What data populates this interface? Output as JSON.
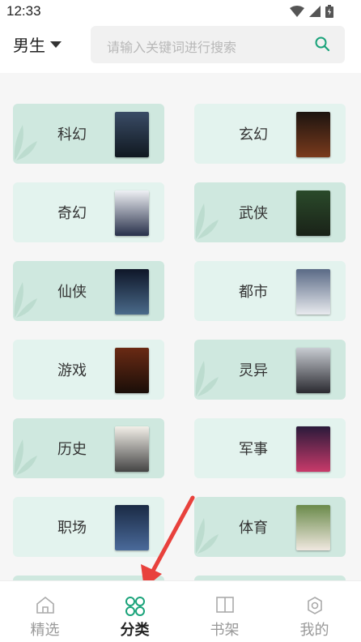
{
  "status_bar": {
    "time": "12:33"
  },
  "header": {
    "gender_label": "男生",
    "search_placeholder": "请输入关键词进行搜索"
  },
  "categories": [
    {
      "label": "科幻",
      "cover_color": "#1e2a3a"
    },
    {
      "label": "玄幻",
      "cover_color": "#3a2418"
    },
    {
      "label": "奇幻",
      "cover_color": "#2a2f44"
    },
    {
      "label": "武侠",
      "cover_color": "#1f3320"
    },
    {
      "label": "仙侠",
      "cover_color": "#1c2c46"
    },
    {
      "label": "都市",
      "cover_color": "#2c3444"
    },
    {
      "label": "游戏",
      "cover_color": "#4a2a1a"
    },
    {
      "label": "灵异",
      "cover_color": "#3e3e44"
    },
    {
      "label": "历史",
      "cover_color": "#d8d4cc"
    },
    {
      "label": "军事",
      "cover_color": "#6a2a50"
    },
    {
      "label": "职场",
      "cover_color": "#2a3b5a"
    },
    {
      "label": "体育",
      "cover_color": "#d8d0c8"
    }
  ],
  "tabbar": {
    "tabs": [
      {
        "label": "精选",
        "icon": "home-icon"
      },
      {
        "label": "分类",
        "icon": "category-icon"
      },
      {
        "label": "书架",
        "icon": "bookshelf-icon"
      },
      {
        "label": "我的",
        "icon": "profile-icon"
      }
    ],
    "active": "分类"
  },
  "colors": {
    "accent": "#1aa37a",
    "card_dark": "#cfe8df",
    "card_light": "#e3f3ee",
    "arrow": "#e8413c"
  }
}
